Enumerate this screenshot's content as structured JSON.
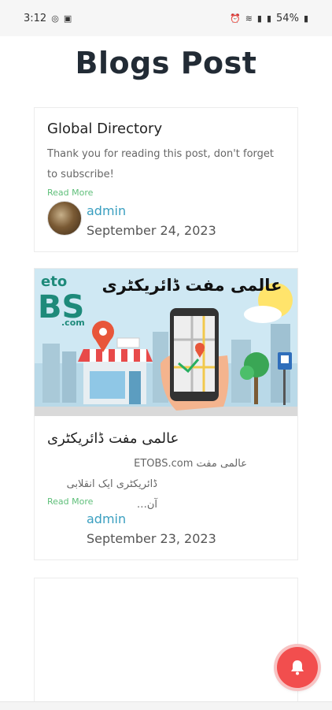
{
  "status_bar": {
    "time": "3:12",
    "battery": "54%"
  },
  "page": {
    "title": "Blogs Post"
  },
  "posts": [
    {
      "title": "Global Directory",
      "excerpt": " Thank you for reading this post, don't forget to subscribe!",
      "read_more": "Read More",
      "author": "admin",
      "date": "September 24, 2023"
    },
    {
      "title": "عالمی مفت ڈائریکٹری",
      "excerpt_line1": "عالمی مفت ETOBS.com",
      "excerpt_line2": "ڈائریکٹری ایک انقلابی آن…",
      "read_more": "Read More",
      "author": "admin",
      "date": "September 23, 2023",
      "image": {
        "logo_top": "eto",
        "logo_main": "BS",
        "logo_sub": ".com",
        "banner_text": "عالمی مفت ڈائریکٹری"
      }
    }
  ],
  "colors": {
    "accent_link": "#3a9fc0",
    "read_more": "#5fbf7a",
    "notify_button": "#f24e4e"
  }
}
